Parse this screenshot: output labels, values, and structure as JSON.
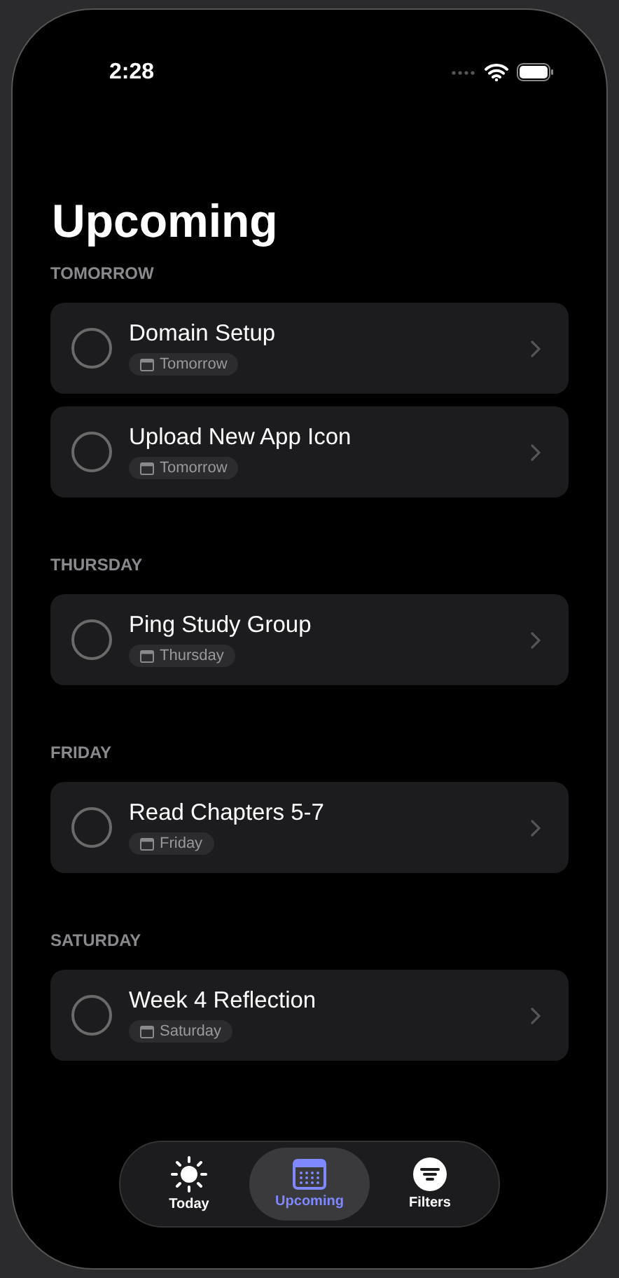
{
  "status_bar": {
    "time": "2:28"
  },
  "title": "Upcoming",
  "sections": [
    {
      "header": "TOMORROW",
      "tasks": [
        {
          "title": "Domain Setup",
          "due": "Tomorrow",
          "checked": false
        },
        {
          "title": "Upload New App Icon",
          "due": "Tomorrow",
          "checked": false
        }
      ]
    },
    {
      "header": "THURSDAY",
      "tasks": [
        {
          "title": "Ping Study Group",
          "due": "Thursday",
          "checked": false
        }
      ]
    },
    {
      "header": "FRIDAY",
      "tasks": [
        {
          "title": "Read Chapters 5-7",
          "due": "Friday",
          "checked": false
        }
      ]
    },
    {
      "header": "SATURDAY",
      "tasks": [
        {
          "title": "Week 4 Reflection",
          "due": "Saturday",
          "checked": false
        }
      ]
    }
  ],
  "tab_bar": [
    {
      "label": "Today",
      "kind": "sun",
      "selected": false
    },
    {
      "label": "Upcoming",
      "kind": "calendar",
      "selected": true
    },
    {
      "label": "Filters",
      "kind": "filter",
      "selected": false
    }
  ]
}
